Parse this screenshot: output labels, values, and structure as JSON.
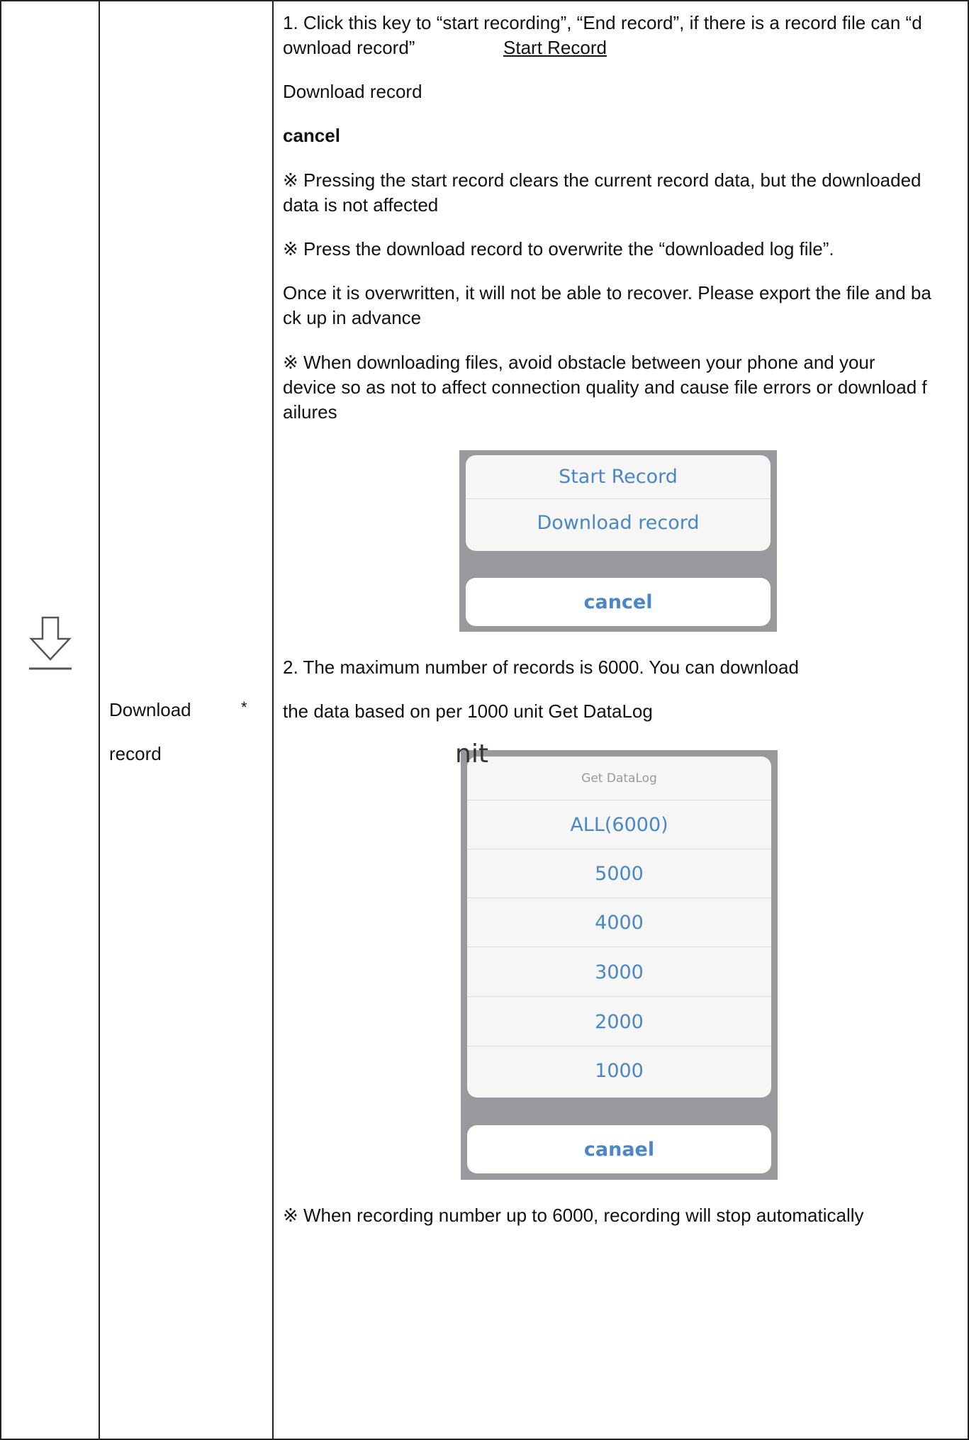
{
  "icon": "download-arrow-icon",
  "function_name": {
    "line1": "Download",
    "line2": "record",
    "asterisk": "*"
  },
  "description": {
    "p1_line1": "1.  Click this key to “start recording”, “End record”, if there is a record file can “d",
    "p1_line2_a": "ownload record”",
    "p1_line2_b": "Start Record",
    "p2": "Download record",
    "p3": "cancel",
    "p4_line1": "※ Pressing the start record clears the current record data, but the downloaded",
    "p4_line2": "data is not affected",
    "p5": "※ Press the download record to overwrite the “downloaded log file”.",
    "p6_line1": "Once it is overwritten, it will not be able to recover. Please export the file and ba",
    "p6_line2": "ck up in advance",
    "p7_line1": "※ When downloading files, avoid obstacle between your phone and your",
    "p7_line2": "device so as not to affect connection quality and cause file errors or download f",
    "p7_line3": "ailures",
    "p8": "2.  The maximum number of records is 6000. You can download",
    "p9": "the data based on per 1000 unit Get DataLog",
    "stray": "nit",
    "p10": "※ When recording number up to 6000, recording will stop automatically"
  },
  "sheet1": {
    "start_record": "Start Record",
    "download_record": "Download record",
    "cancel": "cancel"
  },
  "sheet2": {
    "title": "Get DataLog",
    "options": [
      "ALL(6000)",
      "5000",
      "4000",
      "3000",
      "2000",
      "1000"
    ],
    "cancel": "canael"
  },
  "colors": {
    "link_blue": "#4a86c8",
    "sheet_gray": "#98999c"
  }
}
